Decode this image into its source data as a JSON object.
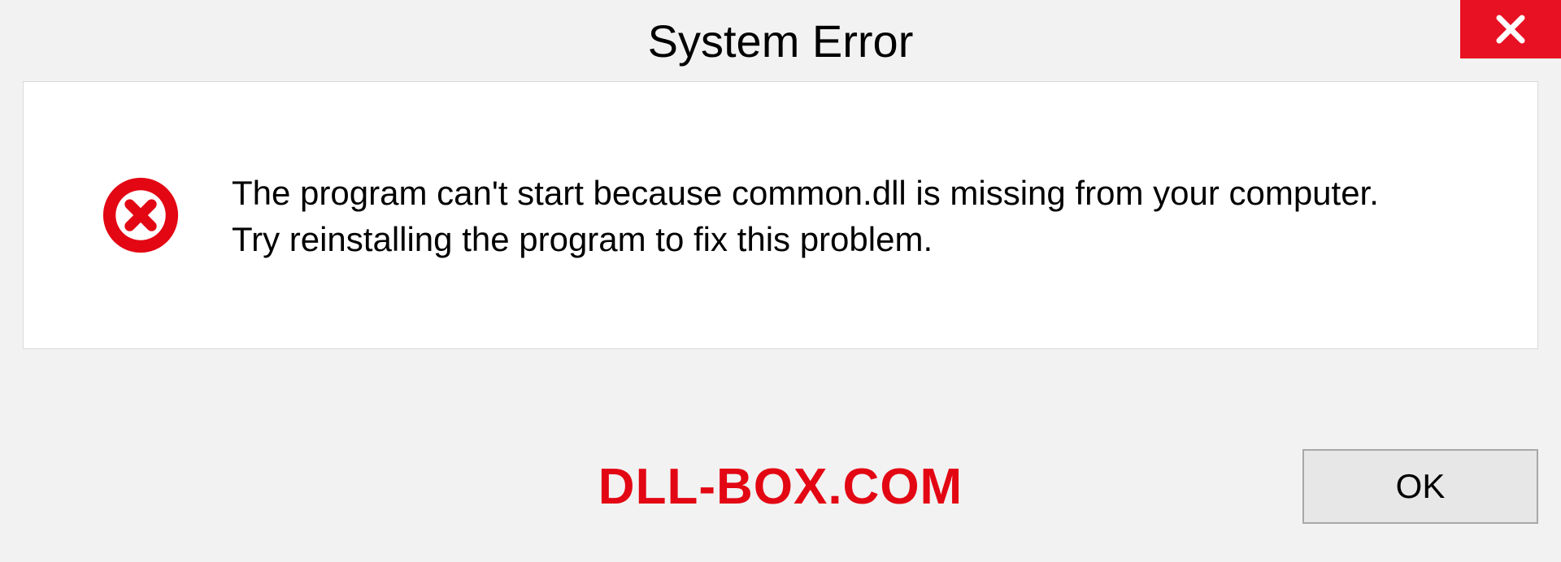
{
  "dialog": {
    "title": "System Error",
    "message_line1": "The program can't start because common.dll is missing from your computer.",
    "message_line2": "Try reinstalling the program to fix this problem.",
    "ok_label": "OK"
  },
  "watermark": "DLL-BOX.COM",
  "colors": {
    "close_bg": "#e81123",
    "error_icon": "#e30613",
    "watermark": "#e30613"
  }
}
